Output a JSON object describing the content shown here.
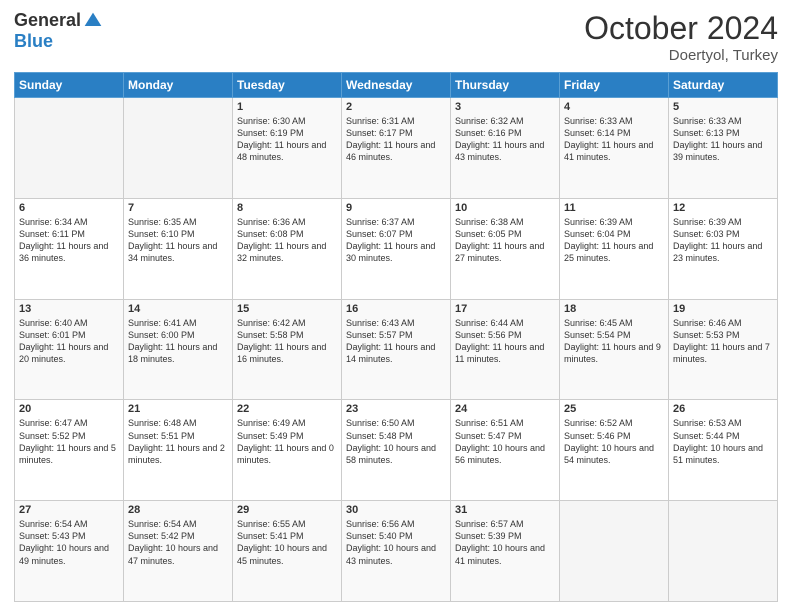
{
  "header": {
    "logo_general": "General",
    "logo_blue": "Blue",
    "month": "October 2024",
    "location": "Doertyol, Turkey"
  },
  "days_of_week": [
    "Sunday",
    "Monday",
    "Tuesday",
    "Wednesday",
    "Thursday",
    "Friday",
    "Saturday"
  ],
  "weeks": [
    [
      {
        "day": "",
        "content": ""
      },
      {
        "day": "",
        "content": ""
      },
      {
        "day": "1",
        "sunrise": "6:30 AM",
        "sunset": "6:19 PM",
        "daylight": "11 hours and 48 minutes."
      },
      {
        "day": "2",
        "sunrise": "6:31 AM",
        "sunset": "6:17 PM",
        "daylight": "11 hours and 46 minutes."
      },
      {
        "day": "3",
        "sunrise": "6:32 AM",
        "sunset": "6:16 PM",
        "daylight": "11 hours and 43 minutes."
      },
      {
        "day": "4",
        "sunrise": "6:33 AM",
        "sunset": "6:14 PM",
        "daylight": "11 hours and 41 minutes."
      },
      {
        "day": "5",
        "sunrise": "6:33 AM",
        "sunset": "6:13 PM",
        "daylight": "11 hours and 39 minutes."
      }
    ],
    [
      {
        "day": "6",
        "sunrise": "6:34 AM",
        "sunset": "6:11 PM",
        "daylight": "11 hours and 36 minutes."
      },
      {
        "day": "7",
        "sunrise": "6:35 AM",
        "sunset": "6:10 PM",
        "daylight": "11 hours and 34 minutes."
      },
      {
        "day": "8",
        "sunrise": "6:36 AM",
        "sunset": "6:08 PM",
        "daylight": "11 hours and 32 minutes."
      },
      {
        "day": "9",
        "sunrise": "6:37 AM",
        "sunset": "6:07 PM",
        "daylight": "11 hours and 30 minutes."
      },
      {
        "day": "10",
        "sunrise": "6:38 AM",
        "sunset": "6:05 PM",
        "daylight": "11 hours and 27 minutes."
      },
      {
        "day": "11",
        "sunrise": "6:39 AM",
        "sunset": "6:04 PM",
        "daylight": "11 hours and 25 minutes."
      },
      {
        "day": "12",
        "sunrise": "6:39 AM",
        "sunset": "6:03 PM",
        "daylight": "11 hours and 23 minutes."
      }
    ],
    [
      {
        "day": "13",
        "sunrise": "6:40 AM",
        "sunset": "6:01 PM",
        "daylight": "11 hours and 20 minutes."
      },
      {
        "day": "14",
        "sunrise": "6:41 AM",
        "sunset": "6:00 PM",
        "daylight": "11 hours and 18 minutes."
      },
      {
        "day": "15",
        "sunrise": "6:42 AM",
        "sunset": "5:58 PM",
        "daylight": "11 hours and 16 minutes."
      },
      {
        "day": "16",
        "sunrise": "6:43 AM",
        "sunset": "5:57 PM",
        "daylight": "11 hours and 14 minutes."
      },
      {
        "day": "17",
        "sunrise": "6:44 AM",
        "sunset": "5:56 PM",
        "daylight": "11 hours and 11 minutes."
      },
      {
        "day": "18",
        "sunrise": "6:45 AM",
        "sunset": "5:54 PM",
        "daylight": "11 hours and 9 minutes."
      },
      {
        "day": "19",
        "sunrise": "6:46 AM",
        "sunset": "5:53 PM",
        "daylight": "11 hours and 7 minutes."
      }
    ],
    [
      {
        "day": "20",
        "sunrise": "6:47 AM",
        "sunset": "5:52 PM",
        "daylight": "11 hours and 5 minutes."
      },
      {
        "day": "21",
        "sunrise": "6:48 AM",
        "sunset": "5:51 PM",
        "daylight": "11 hours and 2 minutes."
      },
      {
        "day": "22",
        "sunrise": "6:49 AM",
        "sunset": "5:49 PM",
        "daylight": "11 hours and 0 minutes."
      },
      {
        "day": "23",
        "sunrise": "6:50 AM",
        "sunset": "5:48 PM",
        "daylight": "10 hours and 58 minutes."
      },
      {
        "day": "24",
        "sunrise": "6:51 AM",
        "sunset": "5:47 PM",
        "daylight": "10 hours and 56 minutes."
      },
      {
        "day": "25",
        "sunrise": "6:52 AM",
        "sunset": "5:46 PM",
        "daylight": "10 hours and 54 minutes."
      },
      {
        "day": "26",
        "sunrise": "6:53 AM",
        "sunset": "5:44 PM",
        "daylight": "10 hours and 51 minutes."
      }
    ],
    [
      {
        "day": "27",
        "sunrise": "6:54 AM",
        "sunset": "5:43 PM",
        "daylight": "10 hours and 49 minutes."
      },
      {
        "day": "28",
        "sunrise": "6:54 AM",
        "sunset": "5:42 PM",
        "daylight": "10 hours and 47 minutes."
      },
      {
        "day": "29",
        "sunrise": "6:55 AM",
        "sunset": "5:41 PM",
        "daylight": "10 hours and 45 minutes."
      },
      {
        "day": "30",
        "sunrise": "6:56 AM",
        "sunset": "5:40 PM",
        "daylight": "10 hours and 43 minutes."
      },
      {
        "day": "31",
        "sunrise": "6:57 AM",
        "sunset": "5:39 PM",
        "daylight": "10 hours and 41 minutes."
      },
      {
        "day": "",
        "content": ""
      },
      {
        "day": "",
        "content": ""
      }
    ]
  ]
}
